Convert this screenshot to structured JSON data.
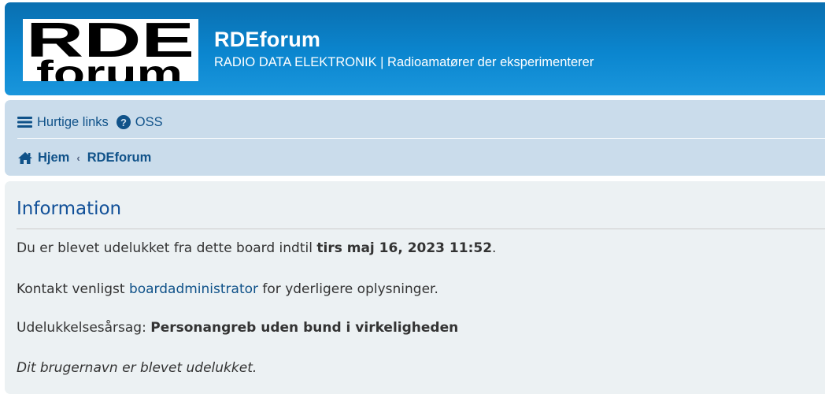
{
  "header": {
    "logo_text_line1": "RDE",
    "logo_text_line2": "forum",
    "site_title": "RDEforum",
    "site_description": "RADIO DATA ELEKTRONIK | Radioamatører der eksperimenterer"
  },
  "nav": {
    "quick_links": {
      "label": "Hurtige links",
      "icon": "bars-icon"
    },
    "faq": {
      "label": "OSS",
      "icon": "question-circle-icon"
    }
  },
  "breadcrumbs": [
    {
      "label": "Hjem",
      "icon": "home-icon"
    },
    {
      "label": "RDEforum"
    }
  ],
  "panel": {
    "title": "Information",
    "ban_until_prefix": "Du er blevet udelukket fra dette board indtil ",
    "ban_until_date": "tirs maj 16, 2023 11:52",
    "ban_until_suffix": ".",
    "contact_prefix": "Kontakt venligst ",
    "contact_link": "boardadministrator",
    "contact_suffix": " for yderligere oplysninger.",
    "reason_label": "Udelukkelsesårsag: ",
    "reason_text": "Personangreb uden bund i virkeligheden",
    "username_banned": "Dit brugernavn er blevet udelukket."
  },
  "colors": {
    "header_gradient_top": "#0a6fb0",
    "header_gradient_bottom": "#1a96dc",
    "navbar_bg": "#cadceb",
    "panel_bg": "#ecf1f3",
    "link": "#105289",
    "title": "#115098"
  }
}
